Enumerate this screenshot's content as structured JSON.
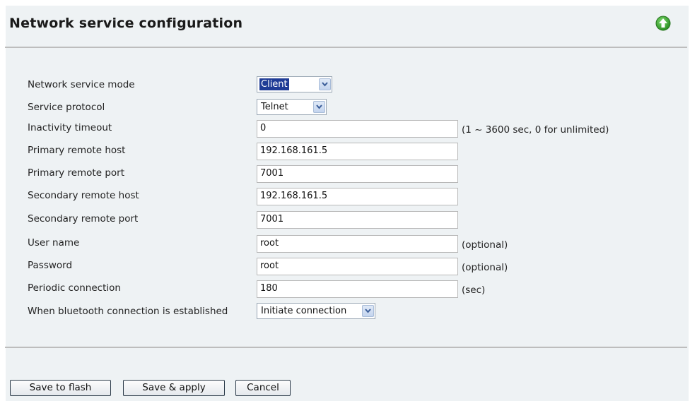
{
  "header": {
    "title": "Network service configuration",
    "icon": "up-arrow-icon",
    "icon_color": "#2e9e2e"
  },
  "form": {
    "network_service_mode": {
      "label": "Network service mode",
      "value": "Client"
    },
    "service_protocol": {
      "label": "Service protocol",
      "value": "Telnet"
    },
    "inactivity_timeout": {
      "label": "Inactivity timeout",
      "value": "0",
      "hint": "(1 ~ 3600 sec, 0 for unlimited)"
    },
    "primary_remote_host": {
      "label": "Primary remote host",
      "value": "192.168.161.5"
    },
    "primary_remote_port": {
      "label": "Primary remote port",
      "value": "7001"
    },
    "secondary_remote_host": {
      "label": "Secondary remote host",
      "value": "192.168.161.5"
    },
    "secondary_remote_port": {
      "label": "Secondary remote port",
      "value": "7001"
    },
    "user_name": {
      "label": "User name",
      "value": "root",
      "hint": "(optional)"
    },
    "password": {
      "label": "Password",
      "value": "root",
      "hint": "(optional)"
    },
    "periodic_connection": {
      "label": "Periodic connection",
      "value": "180",
      "hint": "(sec)"
    },
    "bluetooth_established": {
      "label": "When bluetooth connection is established",
      "value": "Initiate connection"
    }
  },
  "buttons": {
    "save_flash": "Save to flash",
    "save_apply": "Save & apply",
    "cancel": "Cancel"
  },
  "colors": {
    "panel_bg": "#eef2f4",
    "selection": "#1f3c96"
  }
}
